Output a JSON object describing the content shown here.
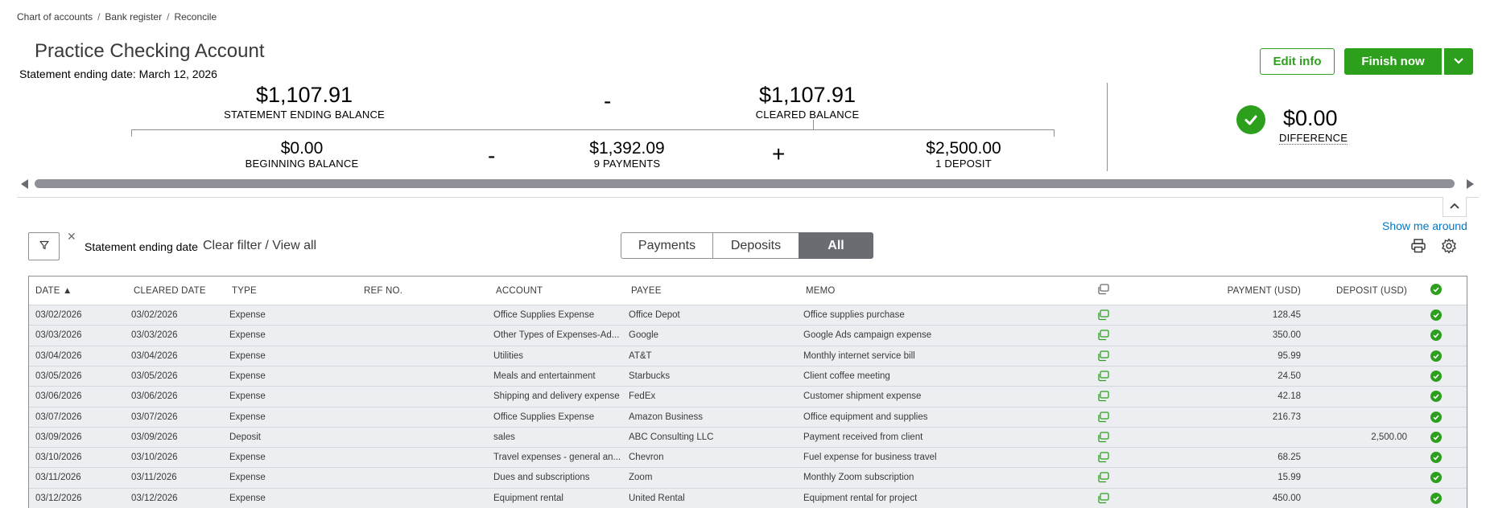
{
  "breadcrumb": [
    "Chart of accounts",
    "Bank register",
    "Reconcile"
  ],
  "breadcrumb_sep": "/",
  "account": {
    "title": "Practice Checking Account",
    "statement_date": "Statement ending date: March 12, 2026"
  },
  "summary": {
    "statement_ending_balance": "$1,107.91",
    "statement_ending_label": "STATEMENT ENDING BALANCE",
    "minus": "-",
    "cleared_balance": "$1,107.91",
    "cleared_label": "CLEARED BALANCE",
    "beginning_balance": "$0.00",
    "beginning_label": "BEGINNING BALANCE",
    "payments_total": "$1,392.09",
    "payments_label": "9 PAYMENTS",
    "plus": "+",
    "deposits_total": "$2,500.00",
    "deposits_label": "1 DEPOSIT",
    "difference": "$0.00",
    "difference_label": "DIFFERENCE"
  },
  "actions": {
    "edit_info": "Edit info",
    "finish_now": "Finish now"
  },
  "help": {
    "show_me_around": "Show me around"
  },
  "filter": {
    "close": "✕",
    "label": "Statement ending date",
    "clear": "Clear filter / View all"
  },
  "segments": [
    "Payments",
    "Deposits",
    "All"
  ],
  "colors": {
    "brand_green": "#2ca01c",
    "link_blue": "#0077c5",
    "row_bg": "#eceef1",
    "selected_segment": "#6b6c72"
  },
  "table": {
    "headers": {
      "date": "DATE ▲",
      "cleared_date": "CLEARED DATE",
      "type": "TYPE",
      "ref_no": "REF NO.",
      "account": "ACCOUNT",
      "payee": "PAYEE",
      "memo": "MEMO",
      "payment": "PAYMENT (USD)",
      "deposit": "DEPOSIT (USD)"
    },
    "rows": [
      {
        "date": "03/02/2026",
        "cleared": "03/02/2026",
        "type": "Expense",
        "ref": "",
        "account": "Office Supplies Expense",
        "payee": "Office Depot",
        "memo": "Office supplies purchase",
        "payment": "128.45",
        "deposit": ""
      },
      {
        "date": "03/03/2026",
        "cleared": "03/03/2026",
        "type": "Expense",
        "ref": "",
        "account": "Other Types of Expenses-Ad...",
        "payee": "Google",
        "memo": "Google Ads campaign expense",
        "payment": "350.00",
        "deposit": ""
      },
      {
        "date": "03/04/2026",
        "cleared": "03/04/2026",
        "type": "Expense",
        "ref": "",
        "account": "Utilities",
        "payee": "AT&T",
        "memo": "Monthly internet service bill",
        "payment": "95.99",
        "deposit": ""
      },
      {
        "date": "03/05/2026",
        "cleared": "03/05/2026",
        "type": "Expense",
        "ref": "",
        "account": "Meals and entertainment",
        "payee": "Starbucks",
        "memo": "Client coffee meeting",
        "payment": "24.50",
        "deposit": ""
      },
      {
        "date": "03/06/2026",
        "cleared": "03/06/2026",
        "type": "Expense",
        "ref": "",
        "account": "Shipping and delivery expense",
        "payee": "FedEx",
        "memo": "Customer shipment expense",
        "payment": "42.18",
        "deposit": ""
      },
      {
        "date": "03/07/2026",
        "cleared": "03/07/2026",
        "type": "Expense",
        "ref": "",
        "account": "Office Supplies Expense",
        "payee": "Amazon Business",
        "memo": "Office equipment and supplies",
        "payment": "216.73",
        "deposit": ""
      },
      {
        "date": "03/09/2026",
        "cleared": "03/09/2026",
        "type": "Deposit",
        "ref": "",
        "account": "sales",
        "payee": "ABC Consulting LLC",
        "memo": "Payment received from client",
        "payment": "",
        "deposit": "2,500.00"
      },
      {
        "date": "03/10/2026",
        "cleared": "03/10/2026",
        "type": "Expense",
        "ref": "",
        "account": "Travel expenses - general an...",
        "payee": "Chevron",
        "memo": "Fuel expense for business travel",
        "payment": "68.25",
        "deposit": ""
      },
      {
        "date": "03/11/2026",
        "cleared": "03/11/2026",
        "type": "Expense",
        "ref": "",
        "account": "Dues and subscriptions",
        "payee": "Zoom",
        "memo": "Monthly Zoom subscription",
        "payment": "15.99",
        "deposit": ""
      },
      {
        "date": "03/12/2026",
        "cleared": "03/12/2026",
        "type": "Expense",
        "ref": "",
        "account": "Equipment rental",
        "payee": "United Rental",
        "memo": "Equipment rental for project",
        "payment": "450.00",
        "deposit": ""
      }
    ]
  }
}
